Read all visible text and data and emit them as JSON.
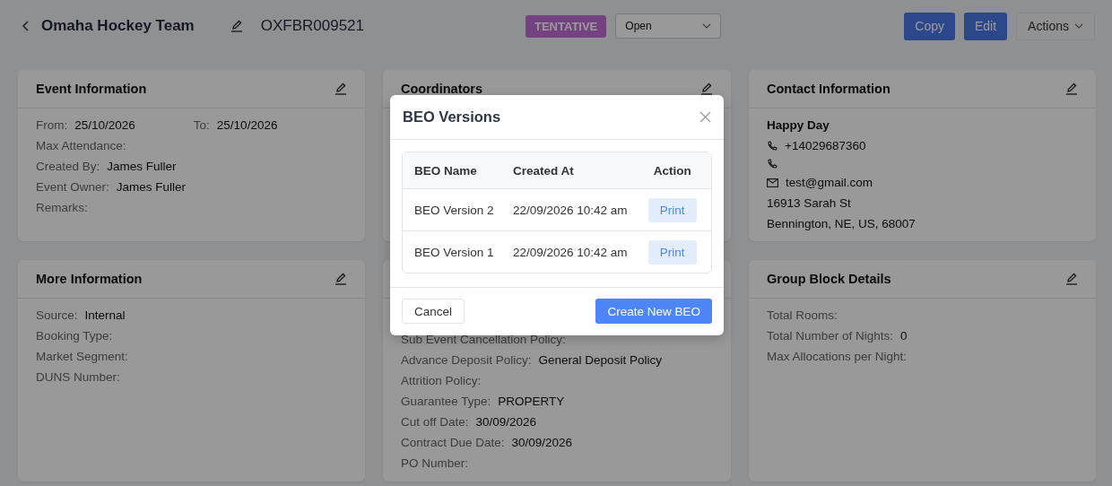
{
  "header": {
    "title": "Omaha Hockey Team",
    "code": "OXFBR009521",
    "status_badge": "TENTATIVE",
    "status_select": "Open",
    "buttons": [
      "Copy",
      "Edit"
    ],
    "actions_menu": "Actions"
  },
  "cards": [
    {
      "kind": "fields",
      "title": "Event Information",
      "rows": [
        [
          {
            "label": "From:",
            "value": "25/10/2026"
          },
          {
            "label": "To:",
            "value": "25/10/2026"
          }
        ],
        [
          {
            "label": "Max Attendance:"
          }
        ],
        [
          {
            "label": "Created By:",
            "value": "James Fuller"
          }
        ],
        [
          {
            "label": "Event Owner:",
            "value": "James Fuller"
          }
        ],
        [
          {
            "label": "Remarks:"
          }
        ]
      ]
    },
    {
      "kind": "fields",
      "title": "Coordinators"
    },
    {
      "kind": "contact",
      "title": "Contact Information",
      "name": "Happy Day",
      "lines": [
        {
          "kind": "phone",
          "text": "+14029687360"
        },
        {
          "kind": "phone"
        },
        {
          "kind": "email",
          "text": "test@gmail.com"
        },
        {
          "kind": "text",
          "text": "16913 Sarah St"
        },
        {
          "kind": "text",
          "text": "Bennington, NE, US, 68007"
        }
      ]
    },
    {
      "kind": "fields",
      "title": "More Information",
      "rows": [
        [
          {
            "label": "Source:",
            "value": "Internal"
          }
        ],
        [
          {
            "label": "Booking Type:"
          }
        ],
        [
          {
            "label": "Market Segment:"
          }
        ],
        [
          {
            "label": "DUNS Number:"
          }
        ]
      ]
    },
    {
      "kind": "fields",
      "rows": [
        [
          {
            "label": "Sub Event Cancellation Policy:"
          }
        ],
        [
          {
            "label": "Advance Deposit Policy:",
            "value": "General Deposit Policy"
          }
        ],
        [
          {
            "label": "Attrition Policy:"
          }
        ],
        [
          {
            "label": "Guarantee Type:",
            "value": "PROPERTY"
          }
        ],
        [
          {
            "label": "Cut off Date:",
            "value": "30/09/2026"
          }
        ],
        [
          {
            "label": "Contract Due Date:",
            "value": "30/09/2026"
          }
        ],
        [
          {
            "label": "PO Number:"
          }
        ]
      ]
    },
    {
      "kind": "fields",
      "title": "Group Block Details",
      "rows": [
        [
          {
            "label": "Total Rooms:"
          }
        ],
        [
          {
            "label": "Total Number of Nights:",
            "value": "0"
          }
        ],
        [
          {
            "label": "Max Allocations per Night:"
          }
        ]
      ]
    }
  ],
  "modal": {
    "title": "BEO Versions",
    "columns": [
      "BEO Name",
      "Created At",
      "Action"
    ],
    "rows": [
      {
        "name": "BEO Version 2",
        "created_at": "22/09/2026 10:42 am",
        "action": "Print"
      },
      {
        "name": "BEO Version 1",
        "created_at": "22/09/2026 10:42 am",
        "action": "Print"
      }
    ],
    "cancel": "Cancel",
    "confirm": "Create New BEO"
  }
}
